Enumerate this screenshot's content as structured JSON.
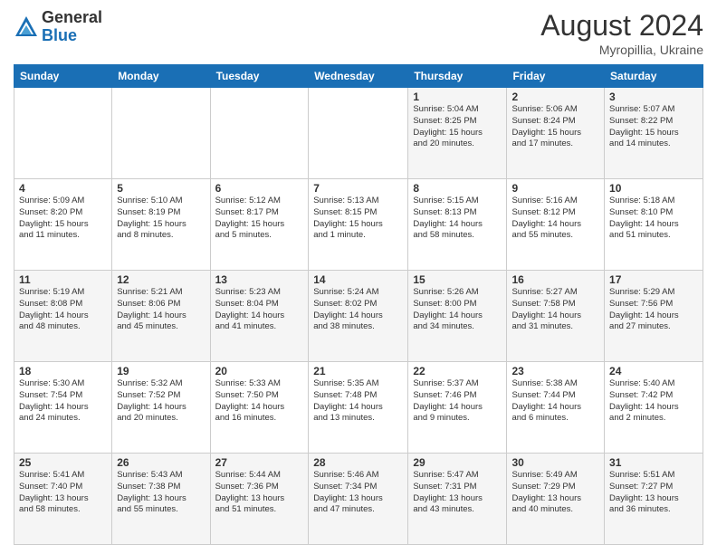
{
  "header": {
    "logo_general": "General",
    "logo_blue": "Blue",
    "month_year": "August 2024",
    "location": "Myropillia, Ukraine"
  },
  "weekdays": [
    "Sunday",
    "Monday",
    "Tuesday",
    "Wednesday",
    "Thursday",
    "Friday",
    "Saturday"
  ],
  "weeks": [
    [
      {
        "day": "",
        "info": ""
      },
      {
        "day": "",
        "info": ""
      },
      {
        "day": "",
        "info": ""
      },
      {
        "day": "",
        "info": ""
      },
      {
        "day": "1",
        "info": "Sunrise: 5:04 AM\nSunset: 8:25 PM\nDaylight: 15 hours\nand 20 minutes."
      },
      {
        "day": "2",
        "info": "Sunrise: 5:06 AM\nSunset: 8:24 PM\nDaylight: 15 hours\nand 17 minutes."
      },
      {
        "day": "3",
        "info": "Sunrise: 5:07 AM\nSunset: 8:22 PM\nDaylight: 15 hours\nand 14 minutes."
      }
    ],
    [
      {
        "day": "4",
        "info": "Sunrise: 5:09 AM\nSunset: 8:20 PM\nDaylight: 15 hours\nand 11 minutes."
      },
      {
        "day": "5",
        "info": "Sunrise: 5:10 AM\nSunset: 8:19 PM\nDaylight: 15 hours\nand 8 minutes."
      },
      {
        "day": "6",
        "info": "Sunrise: 5:12 AM\nSunset: 8:17 PM\nDaylight: 15 hours\nand 5 minutes."
      },
      {
        "day": "7",
        "info": "Sunrise: 5:13 AM\nSunset: 8:15 PM\nDaylight: 15 hours\nand 1 minute."
      },
      {
        "day": "8",
        "info": "Sunrise: 5:15 AM\nSunset: 8:13 PM\nDaylight: 14 hours\nand 58 minutes."
      },
      {
        "day": "9",
        "info": "Sunrise: 5:16 AM\nSunset: 8:12 PM\nDaylight: 14 hours\nand 55 minutes."
      },
      {
        "day": "10",
        "info": "Sunrise: 5:18 AM\nSunset: 8:10 PM\nDaylight: 14 hours\nand 51 minutes."
      }
    ],
    [
      {
        "day": "11",
        "info": "Sunrise: 5:19 AM\nSunset: 8:08 PM\nDaylight: 14 hours\nand 48 minutes."
      },
      {
        "day": "12",
        "info": "Sunrise: 5:21 AM\nSunset: 8:06 PM\nDaylight: 14 hours\nand 45 minutes."
      },
      {
        "day": "13",
        "info": "Sunrise: 5:23 AM\nSunset: 8:04 PM\nDaylight: 14 hours\nand 41 minutes."
      },
      {
        "day": "14",
        "info": "Sunrise: 5:24 AM\nSunset: 8:02 PM\nDaylight: 14 hours\nand 38 minutes."
      },
      {
        "day": "15",
        "info": "Sunrise: 5:26 AM\nSunset: 8:00 PM\nDaylight: 14 hours\nand 34 minutes."
      },
      {
        "day": "16",
        "info": "Sunrise: 5:27 AM\nSunset: 7:58 PM\nDaylight: 14 hours\nand 31 minutes."
      },
      {
        "day": "17",
        "info": "Sunrise: 5:29 AM\nSunset: 7:56 PM\nDaylight: 14 hours\nand 27 minutes."
      }
    ],
    [
      {
        "day": "18",
        "info": "Sunrise: 5:30 AM\nSunset: 7:54 PM\nDaylight: 14 hours\nand 24 minutes."
      },
      {
        "day": "19",
        "info": "Sunrise: 5:32 AM\nSunset: 7:52 PM\nDaylight: 14 hours\nand 20 minutes."
      },
      {
        "day": "20",
        "info": "Sunrise: 5:33 AM\nSunset: 7:50 PM\nDaylight: 14 hours\nand 16 minutes."
      },
      {
        "day": "21",
        "info": "Sunrise: 5:35 AM\nSunset: 7:48 PM\nDaylight: 14 hours\nand 13 minutes."
      },
      {
        "day": "22",
        "info": "Sunrise: 5:37 AM\nSunset: 7:46 PM\nDaylight: 14 hours\nand 9 minutes."
      },
      {
        "day": "23",
        "info": "Sunrise: 5:38 AM\nSunset: 7:44 PM\nDaylight: 14 hours\nand 6 minutes."
      },
      {
        "day": "24",
        "info": "Sunrise: 5:40 AM\nSunset: 7:42 PM\nDaylight: 14 hours\nand 2 minutes."
      }
    ],
    [
      {
        "day": "25",
        "info": "Sunrise: 5:41 AM\nSunset: 7:40 PM\nDaylight: 13 hours\nand 58 minutes."
      },
      {
        "day": "26",
        "info": "Sunrise: 5:43 AM\nSunset: 7:38 PM\nDaylight: 13 hours\nand 55 minutes."
      },
      {
        "day": "27",
        "info": "Sunrise: 5:44 AM\nSunset: 7:36 PM\nDaylight: 13 hours\nand 51 minutes."
      },
      {
        "day": "28",
        "info": "Sunrise: 5:46 AM\nSunset: 7:34 PM\nDaylight: 13 hours\nand 47 minutes."
      },
      {
        "day": "29",
        "info": "Sunrise: 5:47 AM\nSunset: 7:31 PM\nDaylight: 13 hours\nand 43 minutes."
      },
      {
        "day": "30",
        "info": "Sunrise: 5:49 AM\nSunset: 7:29 PM\nDaylight: 13 hours\nand 40 minutes."
      },
      {
        "day": "31",
        "info": "Sunrise: 5:51 AM\nSunset: 7:27 PM\nDaylight: 13 hours\nand 36 minutes."
      }
    ]
  ]
}
